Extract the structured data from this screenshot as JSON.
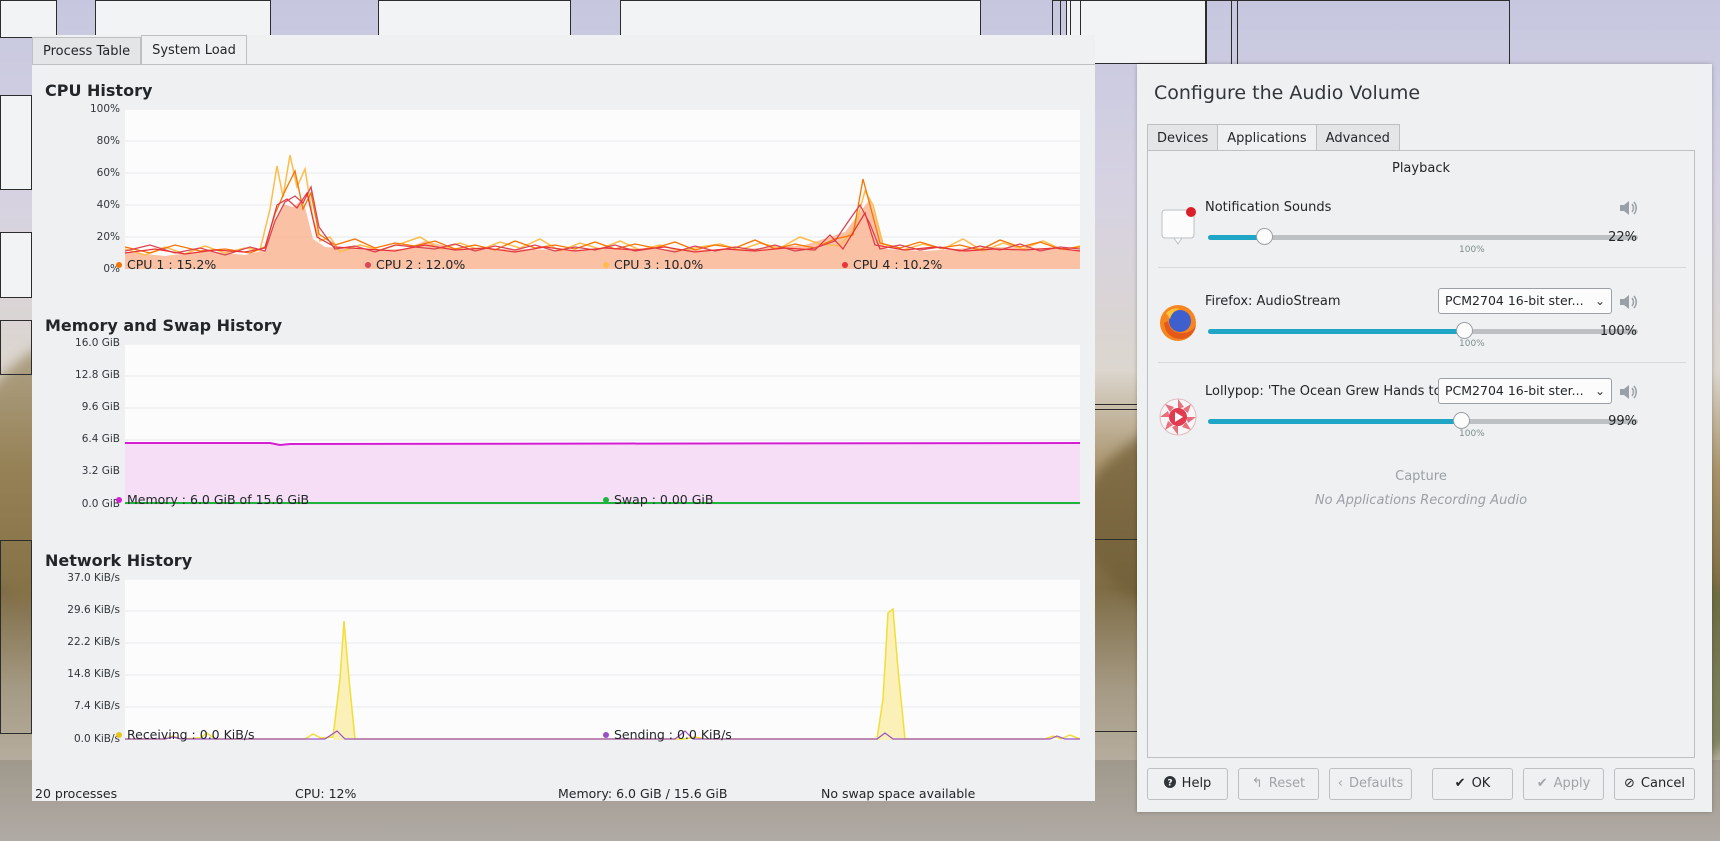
{
  "sysmon": {
    "tabs": [
      "Process Table",
      "System Load"
    ],
    "active_tab": "System Load",
    "cpu": {
      "title": "CPU History",
      "yticks": [
        "100%",
        "80%",
        "60%",
        "40%",
        "20%",
        "0%"
      ],
      "legend": [
        "CPU 1 : 15.2%",
        "CPU 2 : 12.0%",
        "CPU 3 : 10.0%",
        "CPU 4 : 10.2%"
      ]
    },
    "memory": {
      "title": "Memory and Swap History",
      "yticks": [
        "16.0 GiB",
        "12.8 GiB",
        "9.6 GiB",
        "6.4 GiB",
        "3.2 GiB",
        "0.0 GiB"
      ],
      "legend": [
        "Memory : 6.0 GiB of 15.6 GiB",
        "Swap : 0.00 GiB"
      ]
    },
    "network": {
      "title": "Network History",
      "yticks": [
        "37.0 KiB/s",
        "29.6 KiB/s",
        "22.2 KiB/s",
        "14.8 KiB/s",
        "7.4 KiB/s",
        "0.0 KiB/s"
      ],
      "legend": [
        "Receiving : 0.0 KiB/s",
        "Sending : 0.0 KiB/s"
      ]
    },
    "status": {
      "processes": "20 processes",
      "cpu": "CPU: 12%",
      "memory": "Memory: 6.0 GiB / 15.6 GiB",
      "swap": "No swap space available"
    }
  },
  "audio": {
    "title": "Configure the Audio Volume",
    "tabs": [
      "Devices",
      "Applications",
      "Advanced"
    ],
    "active_tab": "Applications",
    "playback_label": "Playback",
    "streams": [
      {
        "name": "Notification Sounds",
        "percent_label": "22%",
        "level": 0.22,
        "icon": "notification-icon",
        "device": ""
      },
      {
        "name": "Firefox: AudioStream",
        "percent_label": "100%",
        "level": 1.0,
        "icon": "firefox-icon",
        "device": "PCM2704 16-bit ster..."
      },
      {
        "name": "Lollypop: 'The Ocean Grew Hands to H...",
        "percent_label": "99%",
        "level": 0.99,
        "icon": "lollypop-icon",
        "device": "PCM2704 16-bit ster..."
      }
    ],
    "hundred_mark": "100%",
    "capture_label": "Capture",
    "capture_empty": "No Applications Recording Audio",
    "buttons": {
      "help": "Help",
      "reset": "Reset",
      "defaults": "Defaults",
      "ok": "OK",
      "apply": "Apply",
      "cancel": "Cancel"
    }
  },
  "colors": {
    "accent": "#1fa5c6",
    "cpu1": "#f67400",
    "cpu2": "#da4453",
    "cpu3": "#fdbc4b",
    "cpu4": "#e8333a",
    "memory": "#d41fd4",
    "swap": "#1db53b",
    "receiving": "#e7c61a",
    "sending": "#9b4fc4"
  }
}
